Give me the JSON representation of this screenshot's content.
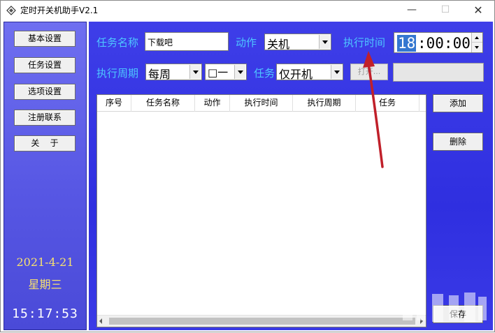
{
  "window": {
    "title": "定时开关机助手V2.1",
    "minimize": "—",
    "maximize": "☐",
    "close": "✕"
  },
  "sidebar": {
    "buttons": [
      "基本设置",
      "任务设置",
      "选项设置",
      "注册联系",
      "关    于"
    ],
    "date": "2021-4-21",
    "weekday": "星期三",
    "clock": "15:17:53"
  },
  "form": {
    "task_name_label": "任务名称",
    "task_name_value": "下载吧",
    "action_label": "动作",
    "action_value": "关机",
    "exec_time_label": "执行时间",
    "time_hour": "18",
    "time_rest": ":00:00",
    "period_label": "执行周期",
    "period_value": "每周",
    "weekday_value": "□一",
    "task_label": "任务",
    "task_value": "仅开机",
    "open_button": "打开..."
  },
  "table": {
    "columns": [
      "序号",
      "任务名称",
      "动作",
      "执行时间",
      "执行周期",
      "任务"
    ],
    "rows": []
  },
  "actions": {
    "add": "添加",
    "delete": "删除",
    "save": "保存"
  },
  "colors": {
    "label_color": "#4ec6ff",
    "date_color": "#f6e070",
    "panel_blue": "#3434e2",
    "arrow_red": "#c0202a"
  }
}
